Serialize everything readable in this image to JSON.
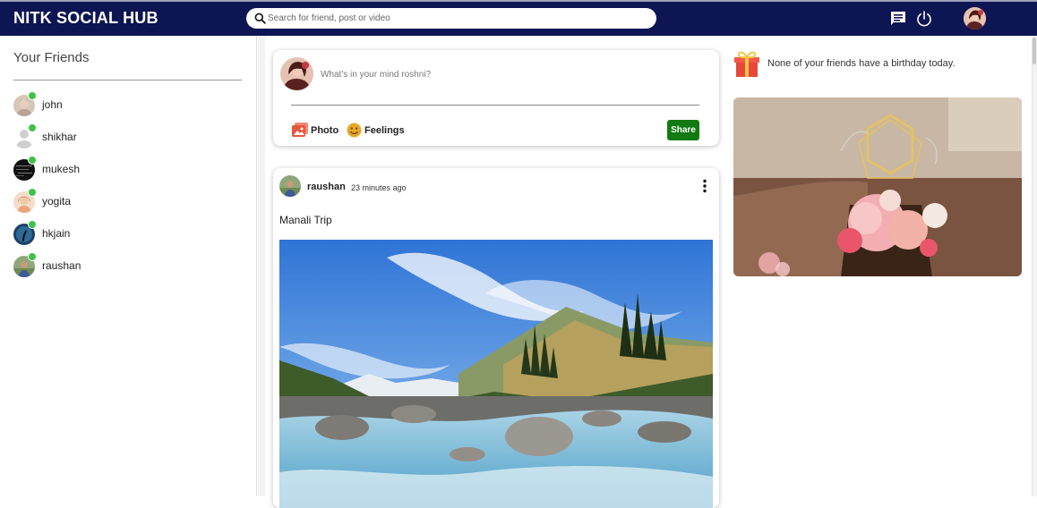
{
  "app": {
    "title": "NITK SOCIAL HUB"
  },
  "search": {
    "placeholder": "Search for friend, post or video"
  },
  "topbar_icons": [
    "chat-icon",
    "power-icon"
  ],
  "sidebar": {
    "title": "Your Friends",
    "friends": [
      {
        "name": "john",
        "online": true
      },
      {
        "name": "shikhar",
        "online": true
      },
      {
        "name": "mukesh",
        "online": true
      },
      {
        "name": "yogita",
        "online": true
      },
      {
        "name": "hkjain",
        "online": true
      },
      {
        "name": "raushan",
        "online": true
      }
    ]
  },
  "composer": {
    "placeholder": "What's in your mind roshni?",
    "photo_label": "Photo",
    "feelings_label": "Feelings",
    "share_label": "Share"
  },
  "post": {
    "user": "raushan",
    "time": "23 minutes ago",
    "caption": "Manali Trip"
  },
  "birthday": {
    "text": "None of your friends have a birthday today."
  },
  "colors": {
    "topbar": "#0d1552",
    "online": "#3dc447",
    "share": "#117a11",
    "photo_icon": "#e4583e",
    "feelings_icon": "#e6a928"
  }
}
